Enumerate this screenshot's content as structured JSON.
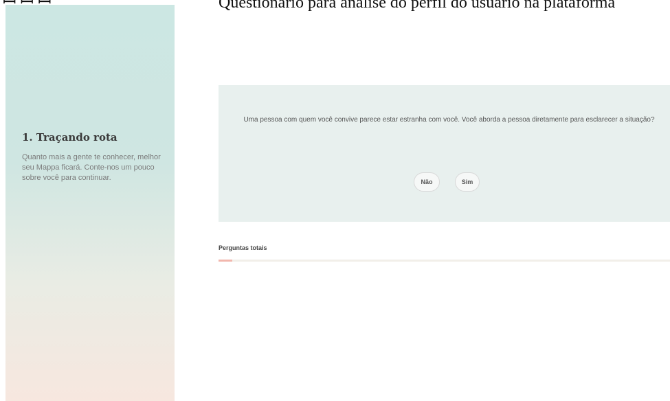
{
  "banner": {
    "fragment_left": "ꟷ ꟷ  ꟷ",
    "fragment_main": "Questionário para análise do perfil do usuário na plataforma"
  },
  "sidebar": {
    "title": "1. Traçando rota",
    "description": "Quanto mais a gente te conhecer, melhor seu Mappa ficará. Conte-nos um pouco sobre você para continuar."
  },
  "question": {
    "text": "Uma pessoa com quem você convive parece estar estranha com você. Você aborda a pessoa diretamente para esclarecer a situação?",
    "answers": [
      "Não",
      "Sim"
    ]
  },
  "progress": {
    "label": "Perguntas totais",
    "fraction": 0.03
  },
  "colors": {
    "card_background": "#e8f0ee",
    "progress_fill": "#f2b7ad",
    "progress_track": "#f2efe9"
  }
}
